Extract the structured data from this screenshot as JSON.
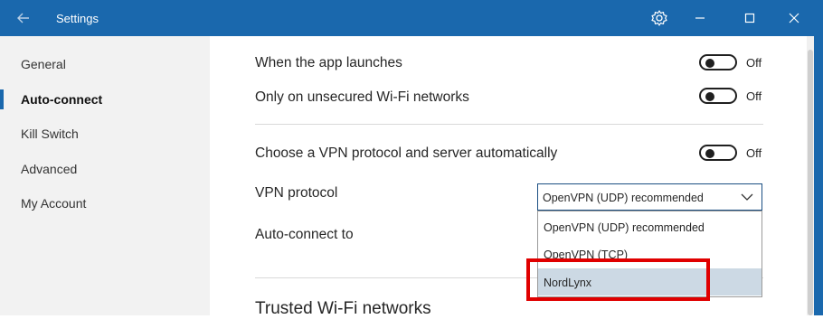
{
  "titlebar": {
    "title": "Settings",
    "back_icon": "back-arrow-icon",
    "gear_icon": "gear-icon",
    "minimize_icon": "minimize-icon",
    "maximize_icon": "maximize-icon",
    "close_icon": "close-icon",
    "bg_color": "#1a68ad"
  },
  "sidebar": {
    "items": [
      {
        "label": "General",
        "active": false
      },
      {
        "label": "Auto-connect",
        "active": true
      },
      {
        "label": "Kill Switch",
        "active": false
      },
      {
        "label": "Advanced",
        "active": false
      },
      {
        "label": "My Account",
        "active": false
      }
    ]
  },
  "settings": {
    "launch_label": "When the app launches",
    "launch_toggle": "Off",
    "unsecured_label": "Only on unsecured Wi-Fi networks",
    "unsecured_toggle": "Off",
    "auto_protocol_label": "Choose a VPN protocol and server automatically",
    "auto_protocol_toggle": "Off",
    "protocol_label": "VPN protocol",
    "protocol_selected": "OpenVPN (UDP) recommended",
    "autoconnect_label": "Auto-connect to",
    "protocol_options": [
      "OpenVPN (UDP) recommended",
      "OpenVPN (TCP)",
      "NordLynx"
    ],
    "hovered_option": "NordLynx",
    "trusted_title": "Trusted Wi-Fi networks"
  },
  "colors": {
    "accent": "#1a68ad",
    "highlight": "#e00000",
    "hover": "#ccd9e4"
  }
}
